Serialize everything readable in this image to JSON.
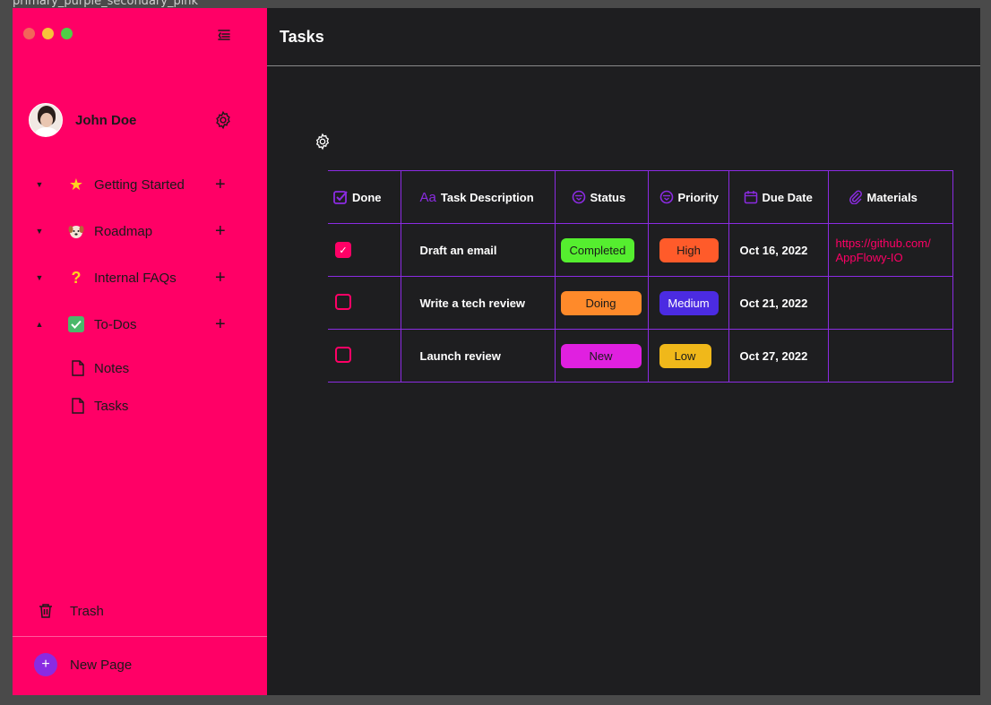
{
  "frame_label": "primary_purple_secondary_pink",
  "colors": {
    "sidebar_bg": "#ff0066",
    "main_bg": "#1e1e20",
    "accent_purple": "#8b2be2",
    "accent_pink": "#ff0066"
  },
  "window_controls": [
    "close",
    "minimize",
    "maximize"
  ],
  "user": {
    "name": "John Doe",
    "avatar_icon": "avatar",
    "settings_icon": "gear-icon"
  },
  "sidebar": {
    "items": [
      {
        "label": "Getting Started",
        "icon": "star-icon",
        "expanded": false
      },
      {
        "label": "Roadmap",
        "icon": "dog-icon",
        "expanded": false
      },
      {
        "label": "Internal FAQs",
        "icon": "question-icon",
        "expanded": false
      },
      {
        "label": "To-Dos",
        "icon": "checkbox-icon",
        "expanded": true
      }
    ],
    "sub_items": [
      {
        "label": "Notes",
        "icon": "document-icon"
      },
      {
        "label": "Tasks",
        "icon": "document-icon"
      }
    ],
    "trash_label": "Trash",
    "new_page_label": "New Page"
  },
  "main": {
    "title": "Tasks",
    "columns": [
      {
        "label": "Done",
        "icon": "checkbox-icon"
      },
      {
        "label": "Task Description",
        "icon": "text-icon",
        "icon_text": "Aa"
      },
      {
        "label": "Status",
        "icon": "select-icon"
      },
      {
        "label": "Priority",
        "icon": "select-icon"
      },
      {
        "label": "Due Date",
        "icon": "calendar-icon"
      },
      {
        "label": "Materials",
        "icon": "paperclip-icon"
      }
    ],
    "rows": [
      {
        "done": true,
        "description": "Draft an email",
        "status": {
          "label": "Completed",
          "color": "#55ee2f"
        },
        "priority": {
          "label": "High",
          "color": "#ff5b2a"
        },
        "due": "Oct 16, 2022",
        "materials_line1": "https://github.com/",
        "materials_line2": "AppFlowy-IO"
      },
      {
        "done": false,
        "description": "Write a tech review",
        "status": {
          "label": "Doing",
          "color": "#ff8a2a"
        },
        "priority": {
          "label": "Medium",
          "color": "#4b2be2"
        },
        "due": "Oct 21, 2022",
        "materials_line1": "",
        "materials_line2": ""
      },
      {
        "done": false,
        "description": "Launch review",
        "status": {
          "label": "New",
          "color": "#e020e0"
        },
        "priority": {
          "label": "Low",
          "color": "#f0b81a"
        },
        "due": "Oct 27, 2022",
        "materials_line1": "",
        "materials_line2": ""
      }
    ]
  }
}
